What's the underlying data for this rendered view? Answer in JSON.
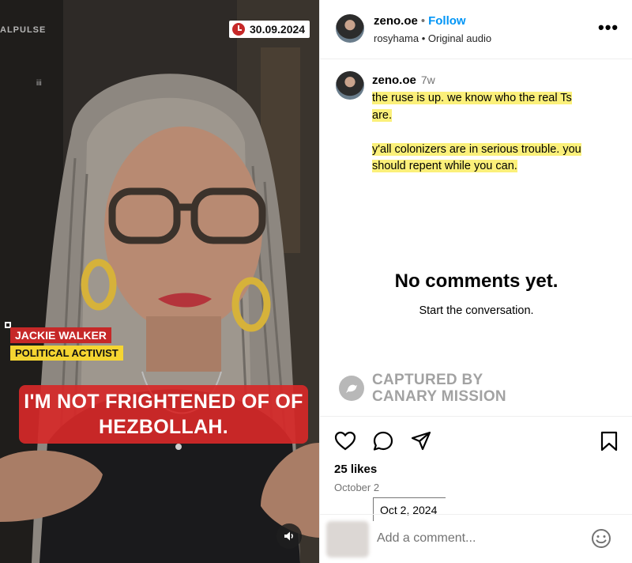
{
  "video": {
    "brand": "ALPULSE",
    "date_badge": "30.09.2024",
    "tiny_mark": "iii",
    "name_tag": "JACKIE WALKER",
    "role_tag": "POLITICAL ACTIVIST",
    "caption_line1": "I'M NOT FRIGHTENED OF OF",
    "caption_line2": "HEZBOLLAH.",
    "sound_icon": "speaker-icon"
  },
  "header": {
    "username": "zeno.oe",
    "separator": "•",
    "follow": "Follow",
    "audio_user": "rosyhama",
    "audio_sep": "•",
    "audio_label": "Original audio",
    "more": "•••"
  },
  "caption": {
    "username": "zeno.oe",
    "time_ago": "7w",
    "line1": "the ruse is up. we know who the real Ts",
    "line2": "are.",
    "line3": "y'all colonizers are in serious trouble. you",
    "line4": "should repent while you can.",
    "highlight_color": "#fbf07a"
  },
  "comments": {
    "empty_title": "No comments yet.",
    "empty_sub": "Start the conversation."
  },
  "watermark": {
    "line1": "CAPTURED BY",
    "line2": "CANARY MISSION"
  },
  "actions": {
    "icons": [
      "heart-icon",
      "comment-icon",
      "share-icon",
      "bookmark-icon"
    ],
    "likes": "25 likes",
    "date": "October 2",
    "tooltip": "Oct 2, 2024"
  },
  "add_comment": {
    "placeholder": "Add a comment...",
    "emoji_icon": "emoji-icon"
  },
  "colors": {
    "link": "#0095f6",
    "muted": "#737373",
    "caption_red": "#d62828",
    "tag_yellow": "#f5d531"
  }
}
